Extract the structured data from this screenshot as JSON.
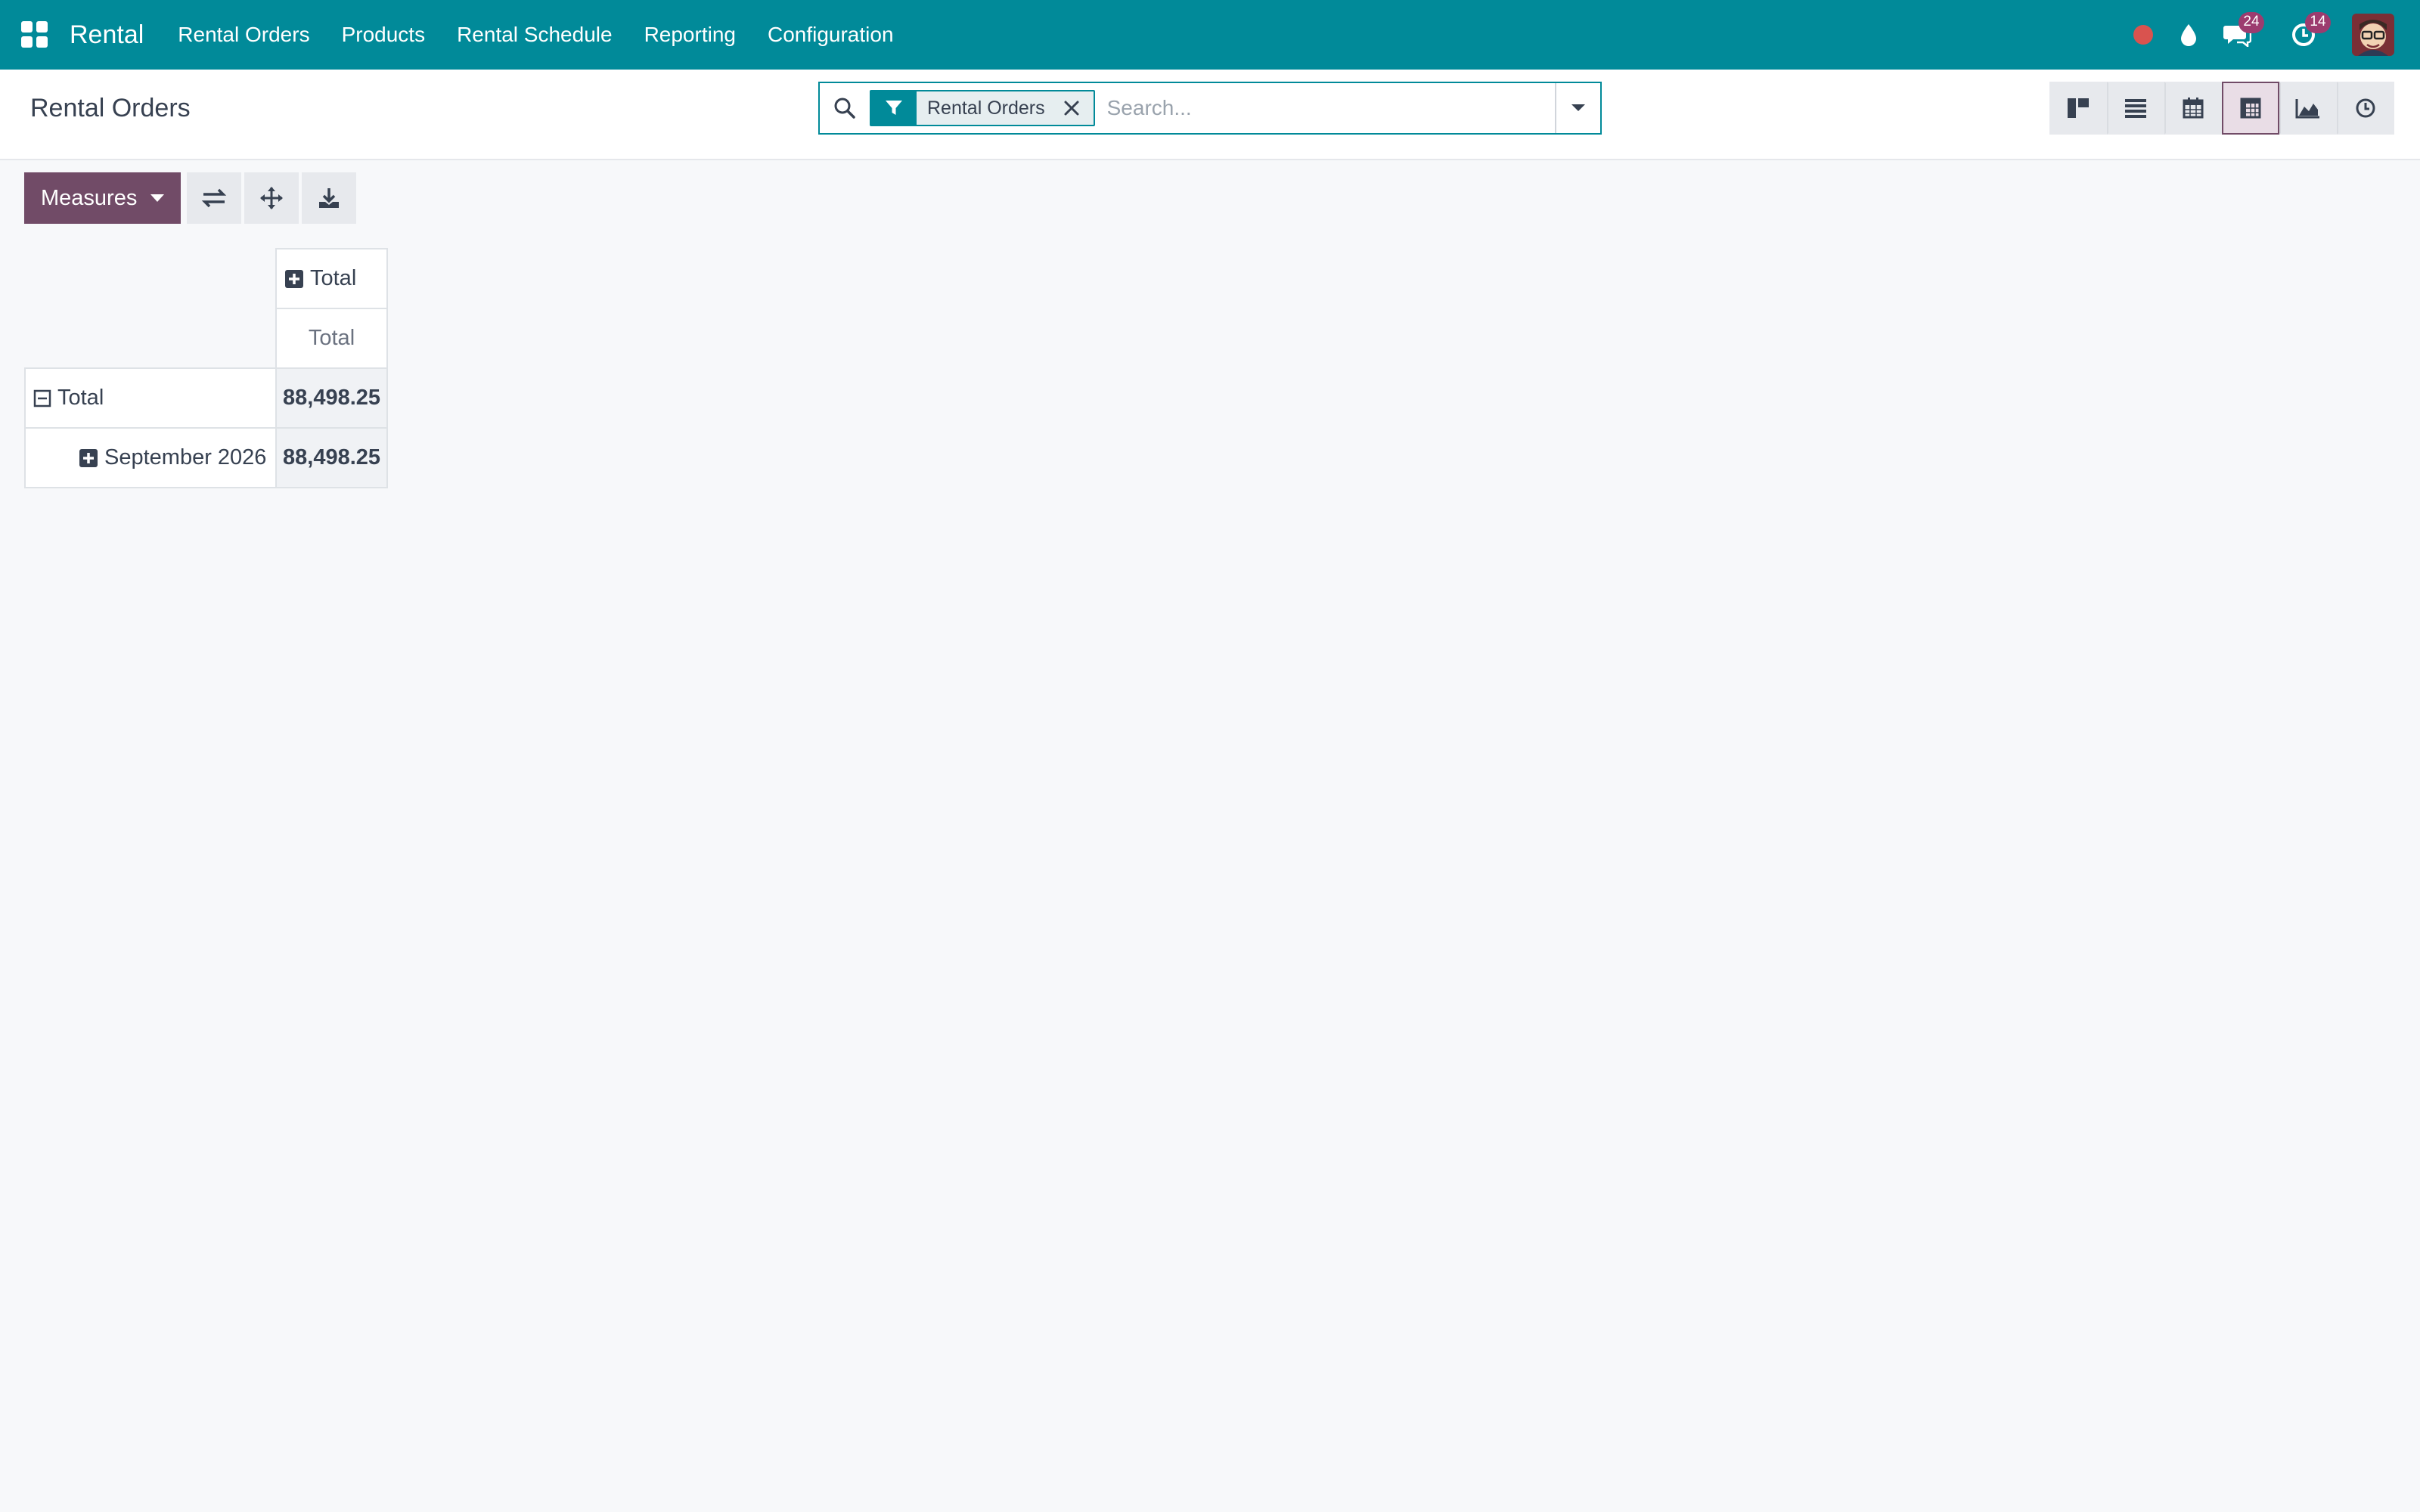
{
  "navbar": {
    "brand": "Rental",
    "menu": [
      "Rental Orders",
      "Products",
      "Rental Schedule",
      "Reporting",
      "Configuration"
    ],
    "messages_count": "24",
    "activities_count": "14"
  },
  "control_panel": {
    "title": "Rental Orders",
    "search": {
      "facet_value": "Rental Orders",
      "placeholder": "Search..."
    },
    "views": [
      "kanban",
      "list",
      "calendar",
      "pivot",
      "graph",
      "activity"
    ],
    "active_view": "pivot"
  },
  "pivot_toolbar": {
    "measures_label": "Measures"
  },
  "pivot": {
    "col_header": "Total",
    "measure_header": "Total",
    "rows": [
      {
        "label": "Total",
        "value": "88,498.25",
        "expanded": true
      },
      {
        "label": "September 2026",
        "value": "88,498.25",
        "expanded": false
      }
    ]
  },
  "colors": {
    "navbar": "#018a99",
    "primary": "#714b67",
    "badge": "#9c3c6f"
  }
}
